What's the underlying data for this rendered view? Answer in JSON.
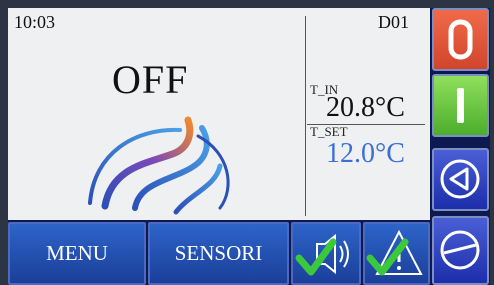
{
  "header": {
    "time": "10:03",
    "device_id": "D01"
  },
  "status": {
    "state": "OFF"
  },
  "temperatures": {
    "t_in_label": "T_IN",
    "t_in_value": "20.8°C",
    "t_set_label": "T_SET",
    "t_set_value": "12.0°C"
  },
  "bottom_bar": {
    "menu_label": "MENU",
    "sensori_label": "SENSORI"
  },
  "side_buttons": [
    "power-off",
    "power-on",
    "back",
    "stop"
  ],
  "colors": {
    "off_button": "#e5563a",
    "on_button": "#6cc843",
    "nav_button": "#2a3fbf",
    "setpoint_text": "#3c6fd6",
    "bottom_button": "#2559b8"
  }
}
